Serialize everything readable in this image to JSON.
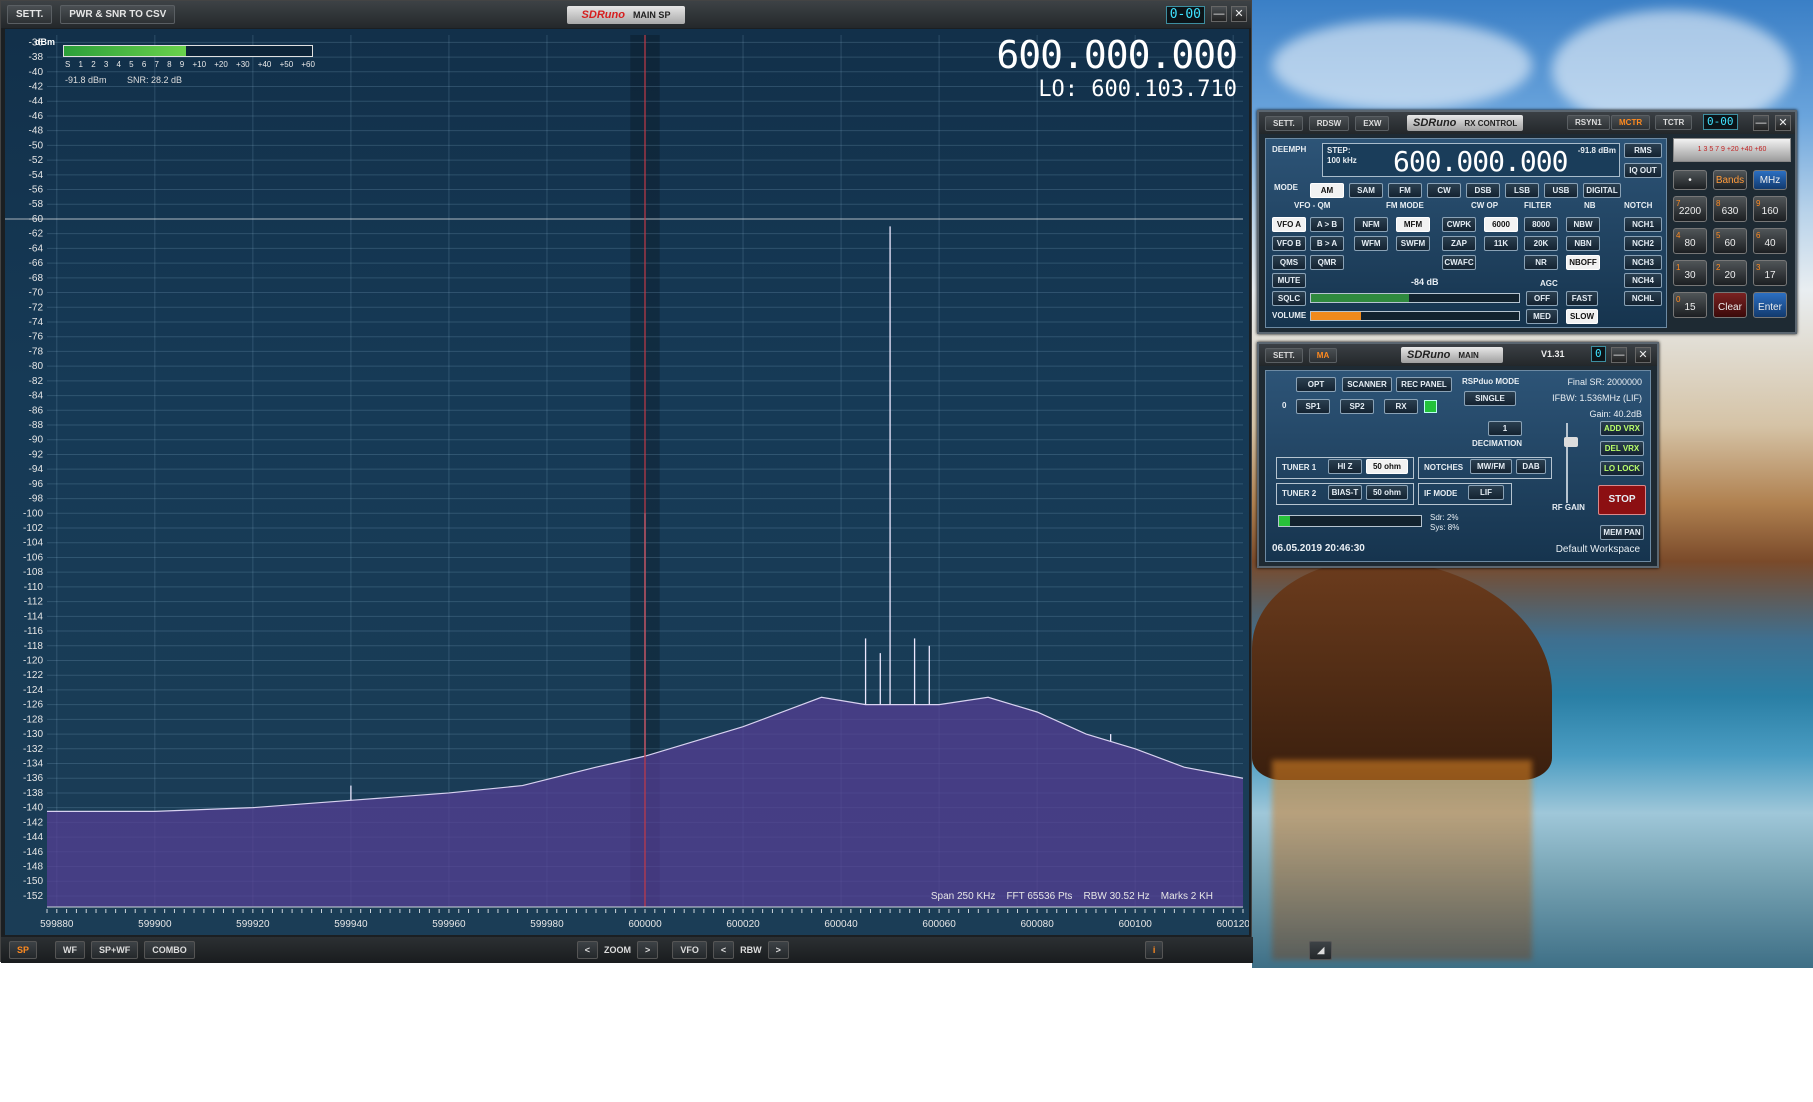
{
  "main_window": {
    "settings_button": "SETT.",
    "csv_button": "PWR & SNR TO CSV",
    "logo_brand": "SDRuno",
    "logo_sub": "MAIN SP",
    "counter": "0-00",
    "minimize": "—",
    "close": "✕",
    "dbm_unit": "dBm",
    "smeter_scale": [
      "S",
      "1",
      "2",
      "3",
      "4",
      "5",
      "6",
      "7",
      "8",
      "9",
      "+10",
      "+20",
      "+30",
      "+40",
      "+50",
      "+60"
    ],
    "smeter_level": 0.49,
    "power_readout": "-91.8 dBm",
    "snr_readout": "SNR: 28.2 dB",
    "frequency": "600.000.000",
    "lo": "LO: 600.103.710",
    "status": "Span 250 KHz    FFT 65536 Pts    RBW 30.52 Hz    Marks 2 KH",
    "bottom": {
      "sp": "SP",
      "wf": "WF",
      "spwf": "SP+WF",
      "combo": "COMBO",
      "zoom_left": "<",
      "zoom": "ZOOM",
      "zoom_right": ">",
      "vfo": "VFO",
      "rbw_left": "<",
      "rbw": "RBW",
      "rbw_right": ">",
      "info": "i",
      "resize": "◢"
    }
  },
  "chart_data": {
    "type": "line",
    "title": "",
    "xlabel": "",
    "ylabel": "dBm",
    "xlim": [
      599878,
      600122
    ],
    "ylim": [
      -153.5,
      -35
    ],
    "yticks": [
      -36,
      -38,
      -40,
      -42,
      -44,
      -46,
      -48,
      -50,
      -52,
      -54,
      -56,
      -58,
      -60,
      -62,
      -64,
      -66,
      -68,
      -70,
      -72,
      -74,
      -76,
      -78,
      -80,
      -82,
      -84,
      -86,
      -88,
      -90,
      -92,
      -94,
      -96,
      -98,
      -100,
      -102,
      -104,
      -106,
      -108,
      -110,
      -112,
      -114,
      -116,
      -118,
      -120,
      -122,
      -124,
      -126,
      -128,
      -130,
      -132,
      -134,
      -136,
      -138,
      -140,
      -142,
      -144,
      -146,
      -148,
      -150,
      -152
    ],
    "xticks": [
      599880,
      599900,
      599920,
      599940,
      599960,
      599980,
      600000,
      600020,
      600040,
      600060,
      600080,
      600100,
      600120
    ],
    "grid": true,
    "noise_floor": [
      [
        599878,
        -140.5
      ],
      [
        599900,
        -140.5
      ],
      [
        599920,
        -140
      ],
      [
        599940,
        -139
      ],
      [
        599960,
        -138
      ],
      [
        599975,
        -137
      ],
      [
        599990,
        -134.5
      ],
      [
        600000,
        -133
      ],
      [
        600010,
        -131
      ],
      [
        600020,
        -129
      ],
      [
        600030,
        -126.5
      ],
      [
        600036,
        -125
      ],
      [
        600045,
        -126
      ],
      [
        600050,
        -126
      ],
      [
        600055,
        -126
      ],
      [
        600060,
        -126
      ],
      [
        600070,
        -125
      ],
      [
        600080,
        -127
      ],
      [
        600090,
        -130
      ],
      [
        600100,
        -132
      ],
      [
        600110,
        -134.5
      ],
      [
        600122,
        -136
      ]
    ],
    "peaks": [
      {
        "x": 600000,
        "y": -100
      },
      {
        "x": 600050,
        "y": -61
      },
      {
        "x": 600045,
        "y": -117
      },
      {
        "x": 600055,
        "y": -117
      },
      {
        "x": 600048,
        "y": -119
      },
      {
        "x": 600058,
        "y": -118
      },
      {
        "x": 599940,
        "y": -137
      },
      {
        "x": 600095,
        "y": -130
      }
    ],
    "reference_line_dbm": -60,
    "vfo_marker": 600000,
    "filter_band": [
      599997,
      600003
    ]
  },
  "rx_control": {
    "sett": "SETT.",
    "rdsw": "RDSW",
    "exw": "EXW",
    "logo_brand": "SDRuno",
    "logo_sub": "RX CONTROL",
    "rsyn1": "RSYN1",
    "mctr": "MCTR",
    "tctr": "TCTR",
    "counter": "0-00",
    "minimize": "—",
    "close": "✕",
    "deemph": "DEEMPH",
    "step": "STEP:",
    "step_val": "100 kHz",
    "freq": "600.000.000",
    "level": "-91.8 dBm",
    "rms": "RMS",
    "iq_out": "IQ OUT",
    "mode_label": "MODE",
    "modes": [
      "AM",
      "SAM",
      "FM",
      "CW",
      "DSB",
      "LSB",
      "USB",
      "DIGITAL"
    ],
    "vfo_qm": "VFO - QM",
    "fm_mode": "FM MODE",
    "cw_op": "CW OP",
    "filter": "FILTER",
    "nb": "NB",
    "notch": "NOTCH",
    "row1": [
      "VFO A",
      "A > B",
      "NFM",
      "MFM",
      "CWPK",
      "6000",
      "8000",
      "NBW",
      "NCH1"
    ],
    "row2": [
      "VFO B",
      "B > A",
      "WFM",
      "SWFM",
      "ZAP",
      "11K",
      "20K",
      "NBN",
      "NCH2"
    ],
    "row3": [
      "QMS",
      "QMR",
      "CWAFC",
      "NR",
      "NBOFF",
      "NCH3"
    ],
    "mute": "MUTE",
    "nch4": "NCH4",
    "sqlc": "SQLC",
    "sql_level": "-84 dB",
    "agc": "AGC",
    "agc_off": "OFF",
    "agc_fast": "FAST",
    "nchl": "NCHL",
    "volume": "VOLUME",
    "agc_med": "MED",
    "agc_slow": "SLOW",
    "sql_fill": 0.47,
    "vol_fill": 0.24,
    "meter_scale": "1 3 5 7 9 +20 +40 +60",
    "keypad": {
      "dot": "•",
      "bands": "Bands",
      "mhz": "MHz",
      "keys": [
        {
          "n": "7",
          "v": "2200"
        },
        {
          "n": "8",
          "v": "630"
        },
        {
          "n": "9",
          "v": "160"
        },
        {
          "n": "4",
          "v": "80"
        },
        {
          "n": "5",
          "v": "60"
        },
        {
          "n": "6",
          "v": "40"
        },
        {
          "n": "1",
          "v": "30"
        },
        {
          "n": "2",
          "v": "20"
        },
        {
          "n": "3",
          "v": "17"
        },
        {
          "n": "0",
          "v": "15"
        }
      ],
      "clear": "Clear",
      "enter": "Enter"
    }
  },
  "main_panel": {
    "sett": "SETT.",
    "ma": "MA",
    "logo_brand": "SDRuno",
    "logo_sub": "MAIN",
    "version": "V1.31",
    "counter": "0",
    "minimize": "—",
    "close": "✕",
    "opt": "OPT",
    "scanner": "SCANNER",
    "rec_panel": "REC PANEL",
    "rspduo_mode": "RSPduo MODE",
    "single": "SINGLE",
    "final_sr": "Final SR: 2000000",
    "ifbw": "IFBW: 1.536MHz (LIF)",
    "gain": "Gain: 40.2dB",
    "zero": "0",
    "sp1": "SP1",
    "sp2": "SP2",
    "rx": "RX",
    "decimation_val": "1",
    "decimation": "DECIMATION",
    "add_vrx": "ADD VRX",
    "del_vrx": "DEL VRX",
    "lo_lock": "LO LOCK",
    "stop": "STOP",
    "mem_pan": "MEM PAN",
    "tuner1": "TUNER 1",
    "hiz": "HI Z",
    "ohm1": "50 ohm",
    "notches": "NOTCHES",
    "mwfm": "MW/FM",
    "dab": "DAB",
    "tuner2": "TUNER 2",
    "biast": "BIAS-T",
    "ohm2": "50 ohm",
    "if_mode": "IF MODE",
    "lif": "LIF",
    "rf_gain": "RF GAIN",
    "sdr": "Sdr: 2%",
    "sys": "Sys: 8%",
    "datetime": "06.05.2019 20:46:30",
    "workspace": "Default Workspace",
    "cpu_fill": 0.08
  }
}
